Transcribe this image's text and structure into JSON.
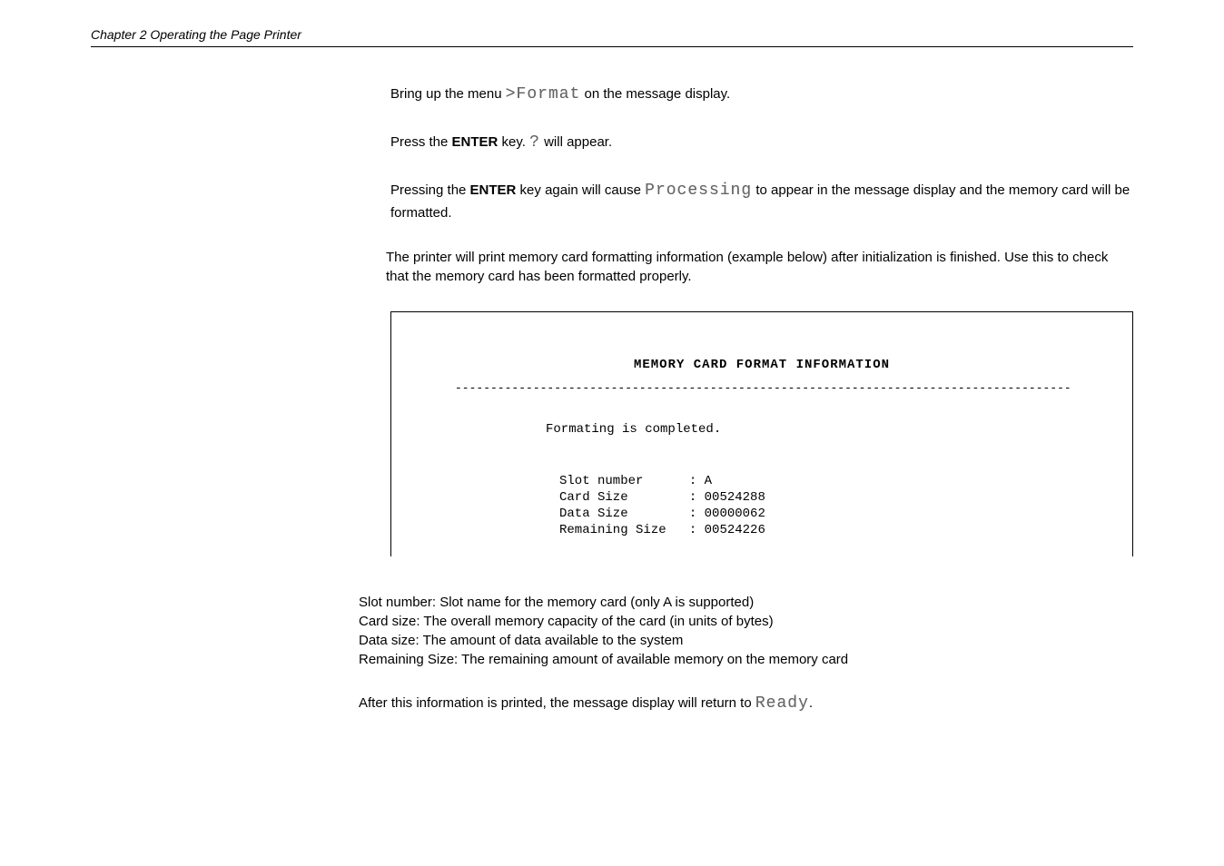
{
  "header": {
    "chapter": "Chapter 2  Operating the Page Printer"
  },
  "paragraphs": {
    "p1_pre": "Bring up the menu ",
    "p1_code": ">Format",
    "p1_post": " on the message display.",
    "p2_pre": "Press the ",
    "p2_bold": "ENTER",
    "p2_mid": " key. ",
    "p2_code": "?",
    "p2_post": " will appear.",
    "p3_pre": "Pressing the ",
    "p3_bold": "ENTER",
    "p3_mid": " key again will cause ",
    "p3_code": "Processing",
    "p3_post": " to appear in the message display and the memory card will be formatted.",
    "p4": "The printer will print memory card formatting information (example below) after initialization is finished.  Use this to check that the memory card has been formatted properly.",
    "final_pre": "After this information is printed, the message display will return to ",
    "final_code": "Ready",
    "final_post": "."
  },
  "info_box": {
    "title": "MEMORY CARD   FORMAT   INFORMATION",
    "dashes": "---------------------------------------------------------------------------------------",
    "status": "Formating is completed.",
    "fields": {
      "slot_label": "Slot number",
      "slot_value": "A",
      "card_label": "Card Size",
      "card_value": "00524288",
      "data_label": "Data Size",
      "data_value": "00000062",
      "remain_label": "Remaining Size",
      "remain_value": "00524226"
    }
  },
  "descriptions": {
    "slot": "Slot number: Slot name for the memory card (only A is supported)",
    "card": "Card size: The overall memory capacity of the card (in units of bytes)",
    "data": "Data size: The amount of data available to the system",
    "remain": "Remaining Size: The remaining amount of available memory on the memory card"
  }
}
